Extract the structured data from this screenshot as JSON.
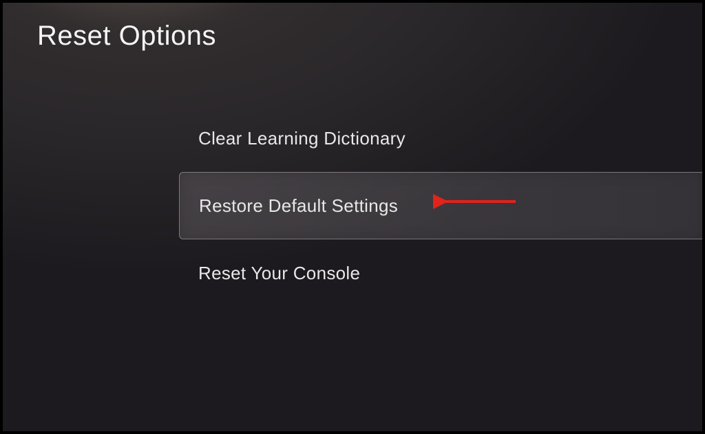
{
  "title": "Reset Options",
  "menu": {
    "items": [
      {
        "label": "Clear Learning Dictionary",
        "selected": false
      },
      {
        "label": "Restore Default Settings",
        "selected": true
      },
      {
        "label": "Reset Your Console",
        "selected": false
      }
    ]
  },
  "annotation": {
    "type": "arrow",
    "color": "#e2231a"
  }
}
